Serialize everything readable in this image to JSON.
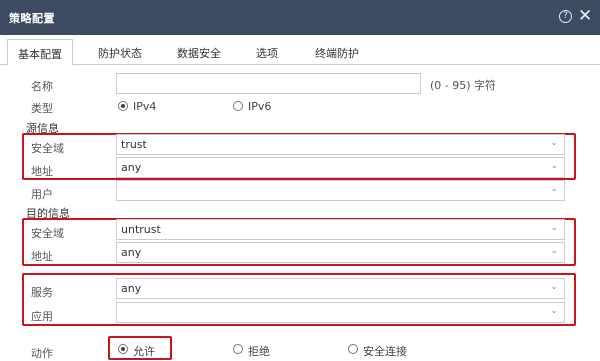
{
  "window": {
    "title": "策略配置",
    "help_symbol": "?",
    "close_symbol": "✕"
  },
  "tabs": [
    {
      "label": "基本配置",
      "active": true
    },
    {
      "label": "防护状态"
    },
    {
      "label": "数据安全"
    },
    {
      "label": "选项"
    },
    {
      "label": "终端防护"
    }
  ],
  "form": {
    "name": {
      "label": "名称",
      "value": "",
      "hint": "(0 - 95) 字符"
    },
    "type": {
      "label": "类型",
      "options": [
        "IPv4",
        "IPv6"
      ],
      "selected": "IPv4"
    },
    "source": {
      "section": "源信息",
      "zone": {
        "label": "安全域",
        "value": "trust"
      },
      "address": {
        "label": "地址",
        "value": "any"
      },
      "user": {
        "label": "用户",
        "value": ""
      }
    },
    "destination": {
      "section": "目的信息",
      "zone": {
        "label": "安全域",
        "value": "untrust"
      },
      "address": {
        "label": "地址",
        "value": "any"
      }
    },
    "service": {
      "label": "服务",
      "value": "any"
    },
    "application": {
      "label": "应用",
      "value": ""
    },
    "action": {
      "label": "动作",
      "options": [
        "允许",
        "拒绝",
        "安全连接"
      ],
      "selected": "允许"
    }
  },
  "colors": {
    "titlebar": "#3d4b62",
    "highlight": "#c9141a",
    "border": "#c6ccd3"
  },
  "icons": {
    "help": "help-icon",
    "close": "close-icon",
    "dropdown": "chevron-down-icon"
  }
}
